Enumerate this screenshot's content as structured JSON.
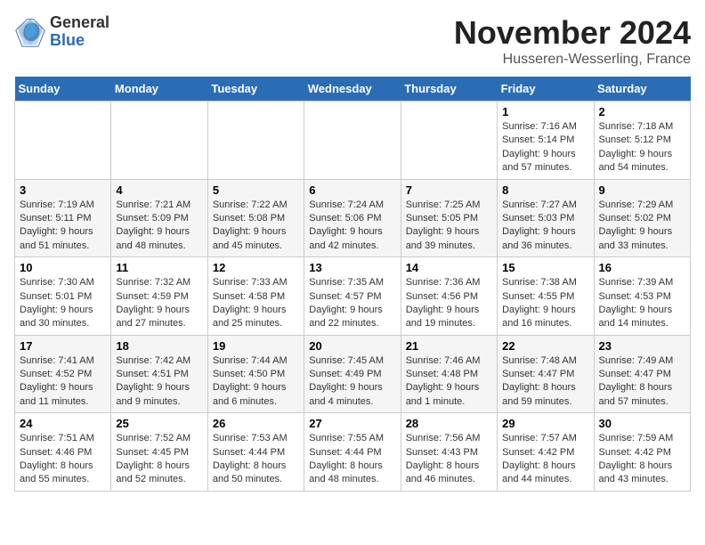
{
  "logo": {
    "general": "General",
    "blue": "Blue"
  },
  "title": "November 2024",
  "subtitle": "Husseren-Wesserling, France",
  "days_of_week": [
    "Sunday",
    "Monday",
    "Tuesday",
    "Wednesday",
    "Thursday",
    "Friday",
    "Saturday"
  ],
  "weeks": [
    [
      {
        "day": "",
        "info": ""
      },
      {
        "day": "",
        "info": ""
      },
      {
        "day": "",
        "info": ""
      },
      {
        "day": "",
        "info": ""
      },
      {
        "day": "",
        "info": ""
      },
      {
        "day": "1",
        "info": "Sunrise: 7:16 AM\nSunset: 5:14 PM\nDaylight: 9 hours and 57 minutes."
      },
      {
        "day": "2",
        "info": "Sunrise: 7:18 AM\nSunset: 5:12 PM\nDaylight: 9 hours and 54 minutes."
      }
    ],
    [
      {
        "day": "3",
        "info": "Sunrise: 7:19 AM\nSunset: 5:11 PM\nDaylight: 9 hours and 51 minutes."
      },
      {
        "day": "4",
        "info": "Sunrise: 7:21 AM\nSunset: 5:09 PM\nDaylight: 9 hours and 48 minutes."
      },
      {
        "day": "5",
        "info": "Sunrise: 7:22 AM\nSunset: 5:08 PM\nDaylight: 9 hours and 45 minutes."
      },
      {
        "day": "6",
        "info": "Sunrise: 7:24 AM\nSunset: 5:06 PM\nDaylight: 9 hours and 42 minutes."
      },
      {
        "day": "7",
        "info": "Sunrise: 7:25 AM\nSunset: 5:05 PM\nDaylight: 9 hours and 39 minutes."
      },
      {
        "day": "8",
        "info": "Sunrise: 7:27 AM\nSunset: 5:03 PM\nDaylight: 9 hours and 36 minutes."
      },
      {
        "day": "9",
        "info": "Sunrise: 7:29 AM\nSunset: 5:02 PM\nDaylight: 9 hours and 33 minutes."
      }
    ],
    [
      {
        "day": "10",
        "info": "Sunrise: 7:30 AM\nSunset: 5:01 PM\nDaylight: 9 hours and 30 minutes."
      },
      {
        "day": "11",
        "info": "Sunrise: 7:32 AM\nSunset: 4:59 PM\nDaylight: 9 hours and 27 minutes."
      },
      {
        "day": "12",
        "info": "Sunrise: 7:33 AM\nSunset: 4:58 PM\nDaylight: 9 hours and 25 minutes."
      },
      {
        "day": "13",
        "info": "Sunrise: 7:35 AM\nSunset: 4:57 PM\nDaylight: 9 hours and 22 minutes."
      },
      {
        "day": "14",
        "info": "Sunrise: 7:36 AM\nSunset: 4:56 PM\nDaylight: 9 hours and 19 minutes."
      },
      {
        "day": "15",
        "info": "Sunrise: 7:38 AM\nSunset: 4:55 PM\nDaylight: 9 hours and 16 minutes."
      },
      {
        "day": "16",
        "info": "Sunrise: 7:39 AM\nSunset: 4:53 PM\nDaylight: 9 hours and 14 minutes."
      }
    ],
    [
      {
        "day": "17",
        "info": "Sunrise: 7:41 AM\nSunset: 4:52 PM\nDaylight: 9 hours and 11 minutes."
      },
      {
        "day": "18",
        "info": "Sunrise: 7:42 AM\nSunset: 4:51 PM\nDaylight: 9 hours and 9 minutes."
      },
      {
        "day": "19",
        "info": "Sunrise: 7:44 AM\nSunset: 4:50 PM\nDaylight: 9 hours and 6 minutes."
      },
      {
        "day": "20",
        "info": "Sunrise: 7:45 AM\nSunset: 4:49 PM\nDaylight: 9 hours and 4 minutes."
      },
      {
        "day": "21",
        "info": "Sunrise: 7:46 AM\nSunset: 4:48 PM\nDaylight: 9 hours and 1 minute."
      },
      {
        "day": "22",
        "info": "Sunrise: 7:48 AM\nSunset: 4:47 PM\nDaylight: 8 hours and 59 minutes."
      },
      {
        "day": "23",
        "info": "Sunrise: 7:49 AM\nSunset: 4:47 PM\nDaylight: 8 hours and 57 minutes."
      }
    ],
    [
      {
        "day": "24",
        "info": "Sunrise: 7:51 AM\nSunset: 4:46 PM\nDaylight: 8 hours and 55 minutes."
      },
      {
        "day": "25",
        "info": "Sunrise: 7:52 AM\nSunset: 4:45 PM\nDaylight: 8 hours and 52 minutes."
      },
      {
        "day": "26",
        "info": "Sunrise: 7:53 AM\nSunset: 4:44 PM\nDaylight: 8 hours and 50 minutes."
      },
      {
        "day": "27",
        "info": "Sunrise: 7:55 AM\nSunset: 4:44 PM\nDaylight: 8 hours and 48 minutes."
      },
      {
        "day": "28",
        "info": "Sunrise: 7:56 AM\nSunset: 4:43 PM\nDaylight: 8 hours and 46 minutes."
      },
      {
        "day": "29",
        "info": "Sunrise: 7:57 AM\nSunset: 4:42 PM\nDaylight: 8 hours and 44 minutes."
      },
      {
        "day": "30",
        "info": "Sunrise: 7:59 AM\nSunset: 4:42 PM\nDaylight: 8 hours and 43 minutes."
      }
    ]
  ]
}
